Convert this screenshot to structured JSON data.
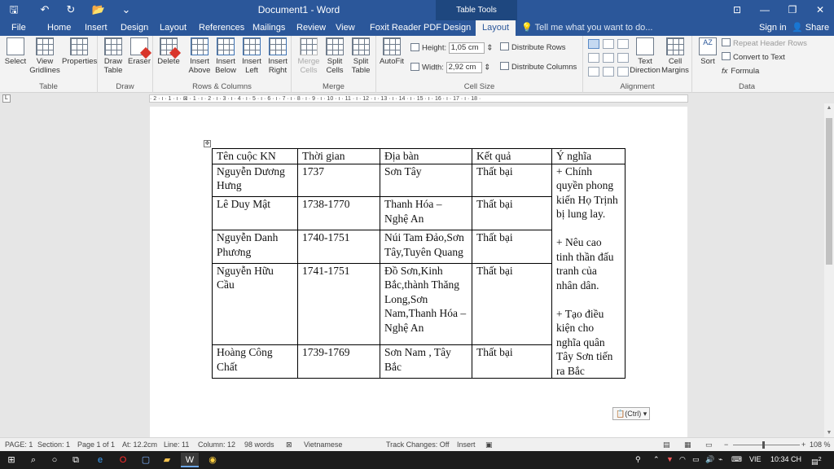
{
  "titlebar": {
    "title": "Document1 - Word",
    "contextual": "Table Tools",
    "qat": {
      "save": "🖫",
      "undo": "↶",
      "redo": "↻",
      "open": "📂",
      "more": "⌄"
    },
    "win": {
      "ribbon_opts": "⊡",
      "minimize": "—",
      "restore": "❐",
      "close": "✕"
    }
  },
  "tabs": [
    "File",
    "Home",
    "Insert",
    "Design",
    "Layout",
    "References",
    "Mailings",
    "Review",
    "View",
    "Foxit Reader PDF",
    "Design",
    "Layout"
  ],
  "tellme": "Tell me what you want to do...",
  "signin": "Sign in",
  "share": "Share",
  "ribbon": {
    "table": {
      "label": "Table",
      "select": "Select",
      "gridlines": "View Gridlines",
      "properties": "Properties"
    },
    "draw": {
      "label": "Draw",
      "draw_table": "Draw Table",
      "eraser": "Eraser"
    },
    "rows_cols": {
      "label": "Rows & Columns",
      "delete": "Delete",
      "above": "Insert Above",
      "below": "Insert Below",
      "left": "Insert Left",
      "right": "Insert Right"
    },
    "merge": {
      "label": "Merge",
      "merge_cells": "Merge Cells",
      "split_cells": "Split Cells",
      "split_table": "Split Table"
    },
    "cell_size": {
      "label": "Cell Size",
      "autofit": "AutoFit",
      "height_label": "Height:",
      "height_value": "1,05 cm",
      "width_label": "Width:",
      "width_value": "2,92 cm",
      "dist_rows": "Distribute Rows",
      "dist_cols": "Distribute Columns"
    },
    "alignment": {
      "label": "Alignment",
      "text_direction": "Text Direction",
      "cell_margins": "Cell Margins"
    },
    "data": {
      "label": "Data",
      "sort": "Sort",
      "repeat_header": "Repeat Header Rows",
      "convert": "Convert to Text",
      "formula": "Formula"
    }
  },
  "ruler": "· 2 · ı · 1 · ı · ⊠ · 1 · ı · 2 · ı · 3 · ı · 4 · ı · 5 · ı · 6 · ı · 7 · ı · 8 · ı · 9 · ı · 10 · ı · 11 · ı · 12 · ı · 13 · ı · 14 · ı · 15 · ı · 16 · ı · 17 · ı · 18 ·",
  "table": {
    "headers": [
      "Tên cuộc KN",
      "Thời gian",
      "Địa bàn",
      "Kết quả",
      "Ý nghĩa"
    ],
    "rows": [
      [
        "Nguyễn Dương Hưng",
        "1737",
        "Sơn Tây",
        "Thất bại"
      ],
      [
        "Lê Duy Mật",
        "1738-1770",
        "Thanh Hóa – Nghệ An",
        "Thất bại"
      ],
      [
        "Nguyễn Danh Phương",
        "1740-1751",
        "Núi Tam Đảo,Sơn Tây,Tuyên Quang",
        "Thất bại"
      ],
      [
        "Nguyễn Hữu Cầu",
        "1741-1751",
        "Đồ Sơn,Kinh Bắc,thành Thăng Long,Sơn Nam,Thanh Hóa – Nghệ An",
        "Thất bại"
      ],
      [
        "Hoàng Công Chất",
        "1739-1769",
        "Sơn Nam , Tây Bắc",
        "Thất bại"
      ]
    ],
    "meaning": [
      "+ Chính quyền phong kiến Họ Trịnh bị lung lay.",
      "+ Nêu cao tinh thần đấu tranh của nhân dân.",
      "+ Tạo điều kiện cho nghĩa quân Tây Sơn tiến ra Bắc"
    ]
  },
  "paste_options": "(Ctrl) ▾",
  "status": {
    "page": "PAGE: 1",
    "section": "Section: 1",
    "pageof": "Page 1 of 1",
    "at": "At: 12.2cm",
    "line": "Line: 11",
    "column": "Column: 12",
    "words": "98 words",
    "language": "Vietnamese",
    "track": "Track Changes: Off",
    "mode": "Insert",
    "zoom": "108 %"
  },
  "taskbar": {
    "lang": "VIE",
    "time": "10:34 CH",
    "notification_count": "2"
  }
}
